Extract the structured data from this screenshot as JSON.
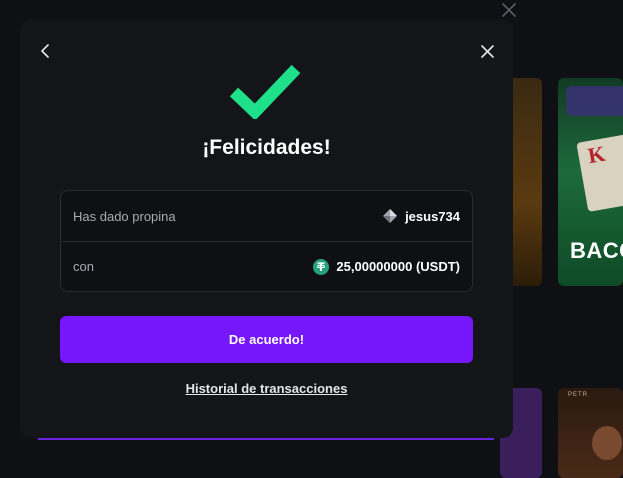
{
  "modal": {
    "title": "¡Felicidades!",
    "details": {
      "tip_label": "Has dado propina",
      "recipient": "jesus734",
      "recipient_icon": "gem-icon",
      "amount_label": "con",
      "amount": "25,00000000 (USDT)",
      "amount_icon": "tether-icon"
    },
    "confirm_label": "De acuerdo!",
    "history_link": "Historial de transacciones",
    "icons": {
      "back": "chevron-left-icon",
      "close": "close-icon",
      "success": "checkmark-icon"
    }
  },
  "background": {
    "card_word": "BACC",
    "card_word_2": "PETR"
  },
  "colors": {
    "accent": "#7616fa",
    "success": "#1fe08a",
    "modal_bg": "#141519",
    "tether": "#26a17b"
  }
}
